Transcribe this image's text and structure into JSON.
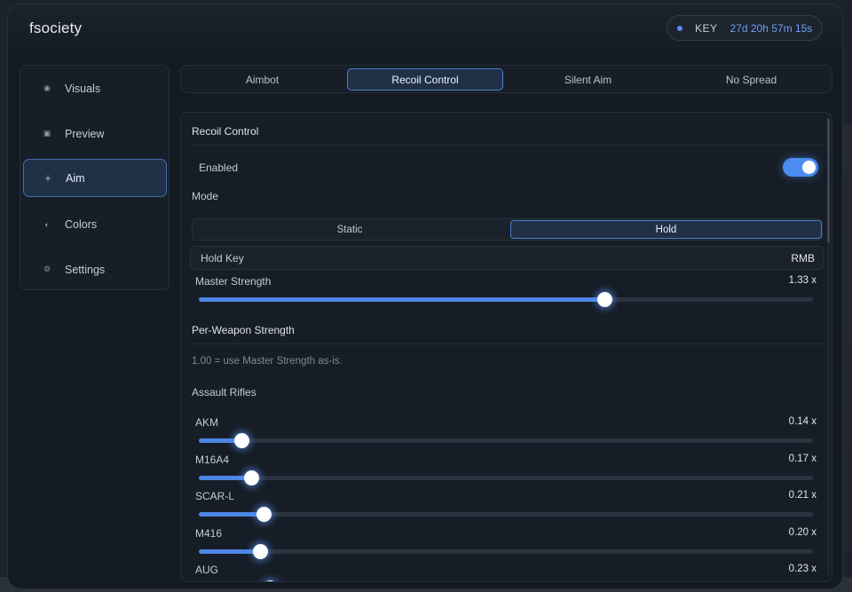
{
  "app": {
    "title": "fsociety"
  },
  "key": {
    "label": "KEY",
    "value": "27d 20h 57m 15s"
  },
  "sidebar": {
    "items": [
      {
        "label": "Visuals",
        "icon": "dot-icon",
        "active": false
      },
      {
        "label": "Preview",
        "icon": "square-icon",
        "active": false
      },
      {
        "label": "Aim",
        "icon": "plus-icon",
        "active": true
      },
      {
        "label": "Colors",
        "icon": "half-circle-icon",
        "active": false
      },
      {
        "label": "Settings",
        "icon": "gear-icon",
        "active": false
      }
    ]
  },
  "tabs": [
    {
      "label": "Aimbot",
      "active": false
    },
    {
      "label": "Recoil Control",
      "active": true
    },
    {
      "label": "Silent Aim",
      "active": false
    },
    {
      "label": "No Spread",
      "active": false
    }
  ],
  "panel": {
    "title": "Recoil Control",
    "enabled_label": "Enabled",
    "enabled": true,
    "mode_label": "Mode",
    "mode_options": [
      {
        "label": "Static",
        "active": false
      },
      {
        "label": "Hold",
        "active": true
      }
    ],
    "hold_key_label": "Hold Key",
    "hold_key_value": "RMB",
    "master": {
      "label": "Master Strength",
      "display": "1.33 x",
      "fraction": 0.66
    },
    "per_weapon_title": "Per-Weapon Strength",
    "per_weapon_hint": "1.00 = use Master Strength as-is.",
    "group_label": "Assault Rifles",
    "weapons": [
      {
        "label": "AKM",
        "display": "0.14 x",
        "fraction": 0.07
      },
      {
        "label": "M16A4",
        "display": "0.17 x",
        "fraction": 0.085
      },
      {
        "label": "SCAR-L",
        "display": "0.21 x",
        "fraction": 0.105
      },
      {
        "label": "M416",
        "display": "0.20 x",
        "fraction": 0.1
      },
      {
        "label": "AUG",
        "display": "0.23 x",
        "fraction": 0.115
      }
    ]
  },
  "colors": {
    "accent": "#4d86e4",
    "active_border": "#4b7fc7"
  }
}
